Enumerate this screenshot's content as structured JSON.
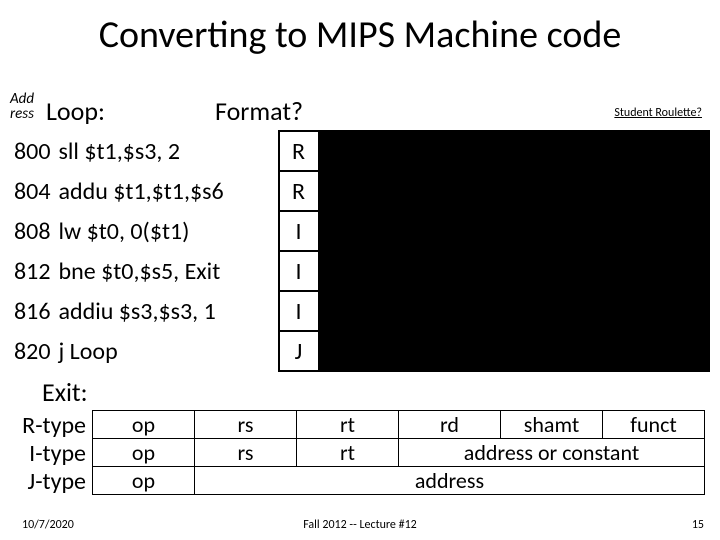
{
  "title": "Converting to MIPS Machine code",
  "labels": {
    "address": "Add\nress",
    "loop": "Loop:",
    "format": "Format?",
    "roulette": "Student Roulette?",
    "exit": "Exit:"
  },
  "rows": [
    {
      "addr": "800",
      "instr": "sll $t1,$s3, 2",
      "fmt": "R"
    },
    {
      "addr": "804",
      "instr": "addu $t1,$t1,$s6",
      "fmt": "R"
    },
    {
      "addr": "808",
      "instr": "lw $t0, 0($t1)",
      "fmt": "I"
    },
    {
      "addr": "812",
      "instr": "bne $t0,$s5, Exit",
      "fmt": "I"
    },
    {
      "addr": "816",
      "instr": "addiu $s3,$s3, 1",
      "fmt": "I"
    },
    {
      "addr": "820",
      "instr": "j Loop",
      "fmt": "J"
    }
  ],
  "types": {
    "r": "R-type",
    "i": "I-type",
    "j": "J-type"
  },
  "fields": {
    "op": "op",
    "rs": "rs",
    "rt": "rt",
    "rd": "rd",
    "shamt": "shamt",
    "funct": "funct",
    "addr_const": "address or constant",
    "address": "address"
  },
  "footer": {
    "date": "10/7/2020",
    "lecture": "Fall 2012 -- Lecture #12",
    "page": "15"
  }
}
